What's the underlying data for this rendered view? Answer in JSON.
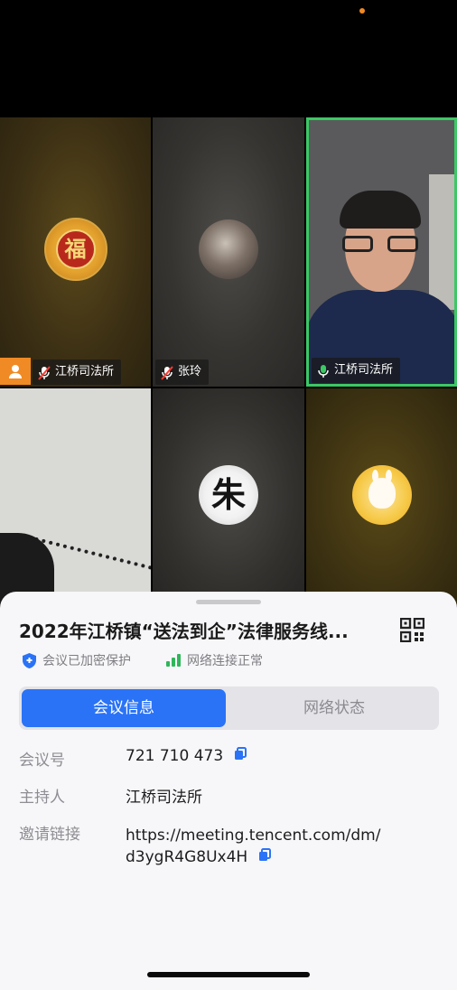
{
  "participants": [
    {
      "name": "江桥司法所",
      "avatar_glyph": "福",
      "mic": "muted",
      "host": true
    },
    {
      "name": "张玲",
      "mic": "muted"
    },
    {
      "name": "江桥司法所",
      "mic": "speaking",
      "active_speaker": true
    },
    {
      "name": "",
      "video": "on"
    },
    {
      "name": "",
      "avatar_glyph": "朱"
    },
    {
      "name": ""
    }
  ],
  "meeting": {
    "title": "2022年江桥镇“送法到企”法律服务线...",
    "encryption_status": "会议已加密保护",
    "network_status": "网络连接正常",
    "tabs": [
      {
        "label": "会议信息",
        "active": true
      },
      {
        "label": "网络状态",
        "active": false
      }
    ],
    "info": {
      "id_label": "会议号",
      "id_value": "721 710 473",
      "host_label": "主持人",
      "host_value": "江桥司法所",
      "link_label": "邀请链接",
      "link_line1": "https://meeting.tencent.com/dm/",
      "link_line2": "d3ygR4G8Ux4H"
    }
  },
  "colors": {
    "accent": "#2a73f7",
    "speaker_border": "#3cc865",
    "host_badge": "#f08a24",
    "network_bars": "#2fb65a"
  },
  "icons": [
    "shield-icon",
    "signal-icon",
    "qr-code-icon",
    "copy-icon",
    "mic-muted-icon",
    "mic-active-icon",
    "host-icon"
  ]
}
